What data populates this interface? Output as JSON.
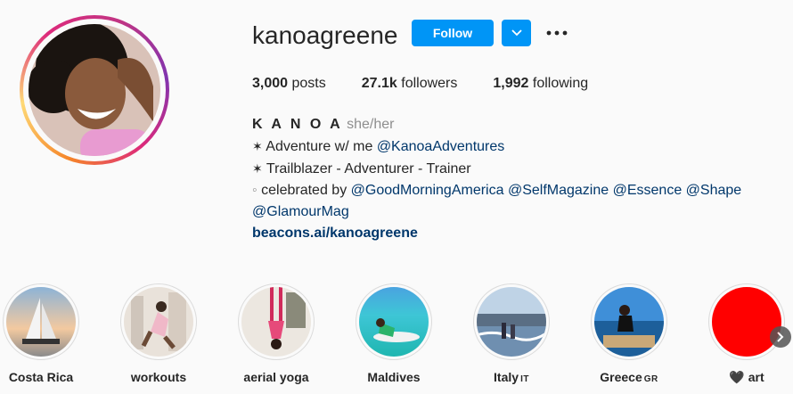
{
  "profile": {
    "username": "kanoagreene",
    "follow_label": "Follow",
    "posts_count": "3,000",
    "posts_label": "posts",
    "followers_count": "27.1k",
    "followers_label": "followers",
    "following_count": "1,992",
    "following_label": "following"
  },
  "bio": {
    "name": "K A N O A",
    "pronouns": "she/her",
    "line1_star": "✶",
    "line1_text": "Adventure w/ me",
    "line1_mention": "@KanoaAdventures",
    "line2_star": "✶",
    "line2_text": "Trailblazer - Adventurer - Trainer",
    "line3_dot": "◦",
    "line3_text": "celebrated by",
    "mentions": [
      "@GoodMorningAmerica",
      "@SelfMagazine",
      "@Essence",
      "@Shape",
      "@GlamourMag"
    ],
    "link": "beacons.ai/kanoagreene"
  },
  "highlights": [
    {
      "label": "Costa Rica",
      "icon": "sailboat-photo"
    },
    {
      "label": "workouts",
      "icon": "workout-photo"
    },
    {
      "label": "aerial yoga",
      "icon": "aerial-yoga-photo"
    },
    {
      "label": "Maldives",
      "icon": "ocean-photo"
    },
    {
      "label": "Italy",
      "flag": "IT",
      "icon": "beach-photo"
    },
    {
      "label": "Greece",
      "flag": "GR",
      "icon": "boat-photo"
    },
    {
      "label": "art",
      "prefix": "🖤",
      "icon": "red-circle"
    }
  ],
  "colors": {
    "accent": "#0095f6",
    "link": "#00376b",
    "muted": "#8e8e8e",
    "text": "#262626",
    "background": "#fafafa",
    "art_highlight": "#ff0000"
  }
}
